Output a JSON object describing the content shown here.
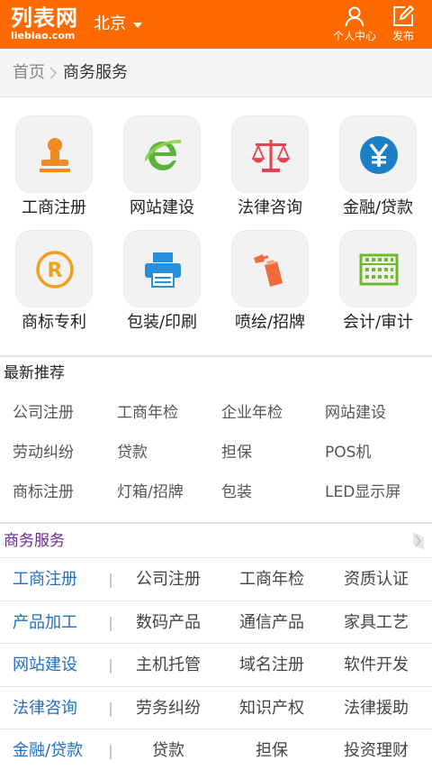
{
  "header": {
    "logo_text": "列表网",
    "logo_sub": "liebiao.com",
    "city": "北京",
    "user_center_label": "个人中心",
    "post_label": "发布",
    "bg_color": "#ff6a00"
  },
  "breadcrumb": {
    "home": "首页",
    "current": "商务服务"
  },
  "categories": [
    {
      "label": "工商注册",
      "icon": "stamp-icon"
    },
    {
      "label": "网站建设",
      "icon": "browser-e-icon"
    },
    {
      "label": "法律咨询",
      "icon": "scales-icon"
    },
    {
      "label": "金融/贷款",
      "icon": "yen-icon"
    },
    {
      "label": "商标专利",
      "icon": "registered-icon"
    },
    {
      "label": "包装/印刷",
      "icon": "printer-icon"
    },
    {
      "label": "喷绘/招牌",
      "icon": "spray-can-icon"
    },
    {
      "label": "会计/审计",
      "icon": "abacus-icon"
    }
  ],
  "latest": {
    "title": "最新推荐",
    "items": [
      "公司注册",
      "工商年检",
      "企业年检",
      "网站建设",
      "劳动纠纷",
      "贷款",
      "担保",
      "POS机",
      "商标注册",
      "灯箱/招牌",
      "包装",
      "LED显示屏"
    ]
  },
  "services": {
    "title": "商务服务",
    "rows": [
      {
        "category": "工商注册",
        "subs": [
          "公司注册",
          "工商年检",
          "资质认证"
        ]
      },
      {
        "category": "产品加工",
        "subs": [
          "数码产品",
          "通信产品",
          "家具工艺"
        ]
      },
      {
        "category": "网站建设",
        "subs": [
          "主机托管",
          "域名注册",
          "软件开发"
        ]
      },
      {
        "category": "法律咨询",
        "subs": [
          "劳务纠纷",
          "知识产权",
          "法律援助"
        ]
      },
      {
        "category": "金融/贷款",
        "subs": [
          "贷款",
          "担保",
          "投资理财"
        ]
      }
    ]
  }
}
